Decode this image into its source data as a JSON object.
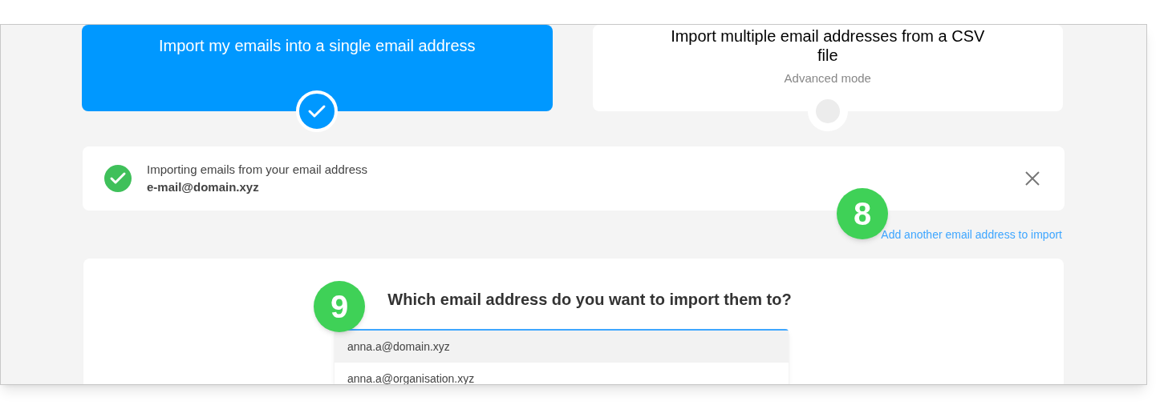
{
  "options": [
    {
      "title": "Import my emails into a single email address",
      "selected": true
    },
    {
      "title": "Import multiple email addresses from a CSV file",
      "subtitle": "Advanced mode",
      "selected": false
    }
  ],
  "notice": {
    "label": "Importing emails from your email address",
    "email": "e-mail@domain.xyz"
  },
  "add_link": "Add another email address to import",
  "question": "Which email address do you want to import them to?",
  "dropdown": {
    "options": [
      {
        "label": "anna.a@domain.xyz",
        "selected": true
      },
      {
        "label": "anna.a@organisation.xyz",
        "selected": false
      }
    ]
  },
  "callouts": [
    "8",
    "9"
  ]
}
